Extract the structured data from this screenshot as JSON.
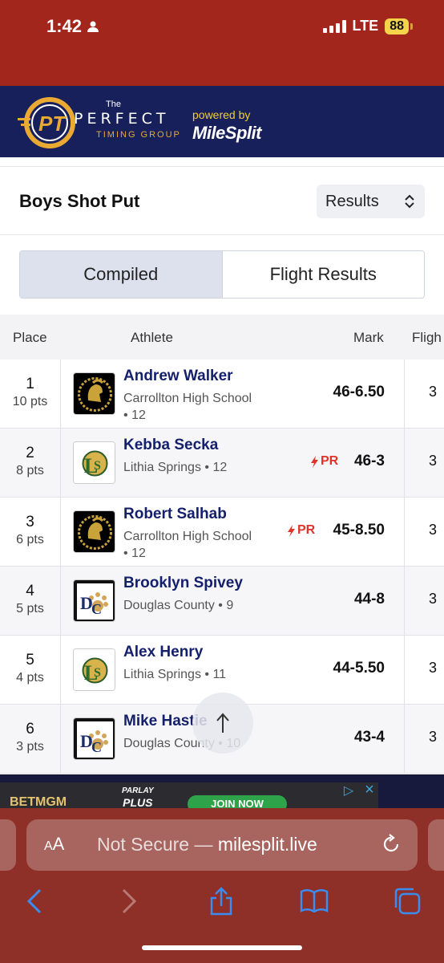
{
  "status": {
    "time": "1:42",
    "network": "LTE",
    "battery": "88"
  },
  "banner": {
    "the": "The",
    "name": "PERFECT",
    "sub": "TIMING GROUP",
    "powered_by": "powered by",
    "brand": "MileSplit"
  },
  "event": {
    "title": "Boys Shot Put",
    "select_value": "Results"
  },
  "tabs": [
    "Compiled",
    "Flight Results"
  ],
  "table": {
    "headers": {
      "place": "Place",
      "athlete": "Athlete",
      "mark": "Mark",
      "flight": "Fligh"
    },
    "rows": [
      {
        "place": "1",
        "pts": "10 pts",
        "name": "Andrew Walker",
        "school": "Carrollton High School • 12",
        "mark": "46-6.50",
        "pr": "",
        "flight": "3",
        "logo": "carrollton"
      },
      {
        "place": "2",
        "pts": "8 pts",
        "name": "Kebba Secka",
        "school": "Lithia Springs • 12",
        "mark": "46-3",
        "pr": "PR",
        "flight": "3",
        "logo": "lithia"
      },
      {
        "place": "3",
        "pts": "6 pts",
        "name": "Robert Salhab",
        "school": "Carrollton High School • 12",
        "mark": "45-8.50",
        "pr": "PR",
        "flight": "3",
        "logo": "carrollton"
      },
      {
        "place": "4",
        "pts": "5 pts",
        "name": "Brooklyn Spivey",
        "school": "Douglas County • 9",
        "mark": "44-8",
        "pr": "",
        "flight": "3",
        "logo": "douglas"
      },
      {
        "place": "5",
        "pts": "4 pts",
        "name": "Alex Henry",
        "school": "Lithia Springs • 11",
        "mark": "44-5.50",
        "pr": "",
        "flight": "3",
        "logo": "lithia"
      },
      {
        "place": "6",
        "pts": "3 pts",
        "name": "Mike Hastie",
        "school": "Douglas County • 10",
        "mark": "43-4",
        "pr": "",
        "flight": "3",
        "logo": "douglas"
      }
    ]
  },
  "ad": {
    "brand": "BETMGM",
    "promo_line1": "PARLAY",
    "promo_line2": "PLUS",
    "cta": "JOIN NOW"
  },
  "safari": {
    "aa": "AA",
    "not_secure": "Not Secure — ",
    "domain": "milesplit.live"
  },
  "colors": {
    "header_red": "#a3261d",
    "banner_navy": "#17205a",
    "name_navy": "#14206b",
    "pr_red": "#e0342b"
  }
}
